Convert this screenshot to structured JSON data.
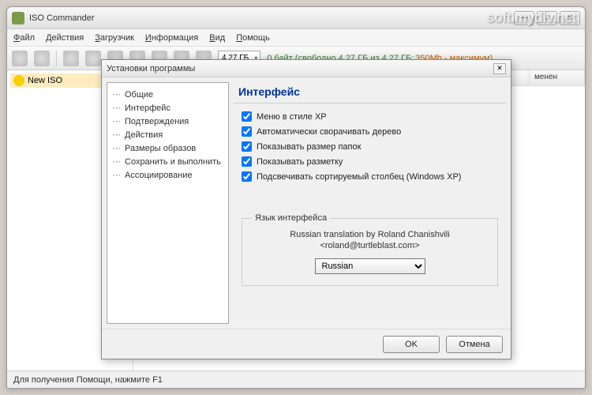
{
  "window": {
    "title": "ISO Commander",
    "menus": [
      "Файл",
      "Действия",
      "Загрузчик",
      "Информация",
      "Вид",
      "Помощь"
    ],
    "statusbar": "Для получения Помощи, нажмите F1"
  },
  "toolbar": {
    "size_combo": "4.27 ГБ",
    "status_text": "0 байт (свободно 4.27 ГБ из 4.27 ГБ; ",
    "status_max": "350Mb - максимум)",
    "status_paren": ")"
  },
  "tree": {
    "new_iso": "New ISO"
  },
  "columns": {
    "changed": "менен"
  },
  "dialog": {
    "title": "Установки программы",
    "categories": [
      "Общие",
      "Интерфейс",
      "Подтверждения",
      "Действия",
      "Размеры образов",
      "Сохранить и выполнить",
      "Ассоциирование"
    ],
    "panel_header": "Интерфейс",
    "checkboxes": [
      "Меню в стиле XP",
      "Автоматически сворачивать дерево",
      "Показывать размер папок",
      "Показывать разметку",
      "Подсвечивать сортируемый столбец (Windows XP)"
    ],
    "lang_legend": "Язык интерфейса",
    "lang_credit1": "Russian translation by Roland Chanishvili",
    "lang_credit2": "<roland@turtleblast.com>",
    "lang_value": "Russian",
    "ok": "OK",
    "cancel": "Отмена"
  },
  "watermark": "soft.mydiv.net"
}
